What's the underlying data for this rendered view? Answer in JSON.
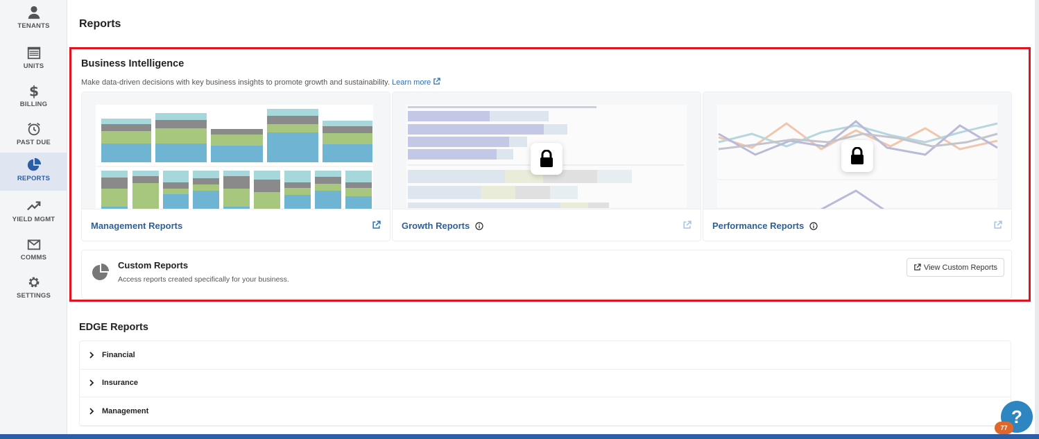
{
  "sidebar": {
    "items": [
      {
        "label": "TENANTS",
        "icon": "person-icon"
      },
      {
        "label": "UNITS",
        "icon": "storage-unit-icon"
      },
      {
        "label": "BILLING",
        "icon": "dollar-icon"
      },
      {
        "label": "PAST DUE",
        "icon": "alarm-clock-icon"
      },
      {
        "label": "REPORTS",
        "icon": "pie-chart-icon",
        "active": true
      },
      {
        "label": "YIELD MGMT",
        "icon": "trend-up-icon"
      },
      {
        "label": "COMMS",
        "icon": "mail-icon"
      },
      {
        "label": "SETTINGS",
        "icon": "gear-icon"
      }
    ]
  },
  "page": {
    "title": "Reports"
  },
  "business_intelligence": {
    "title": "Business Intelligence",
    "description": "Make data-driven decisions with key business insights to promote growth and sustainability.",
    "learn_more": "Learn more",
    "cards": [
      {
        "label": "Management Reports",
        "locked": false
      },
      {
        "label": "Growth Reports",
        "locked": true
      },
      {
        "label": "Performance Reports",
        "locked": true
      }
    ],
    "custom": {
      "title": "Custom Reports",
      "description": "Access reports created specifically for your business.",
      "button": "View Custom Reports"
    }
  },
  "edge_reports": {
    "title": "EDGE Reports",
    "rows": [
      "Financial",
      "Insurance",
      "Management"
    ]
  },
  "help": {
    "icon": "?",
    "badge": "77"
  },
  "colors": {
    "accent": "#2a5ea7",
    "link": "#2d5f99",
    "highlight_border": "#e0141e"
  }
}
